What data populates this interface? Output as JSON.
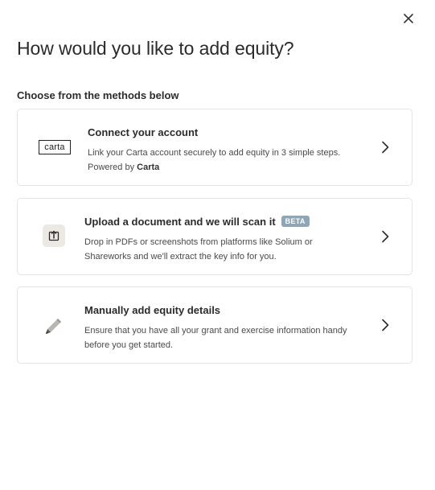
{
  "dialog": {
    "title": "How would you like to add equity?",
    "subtitle": "Choose from the methods below",
    "close_icon": "close-icon"
  },
  "methods": [
    {
      "title": "Connect your account",
      "logo_text": "carta",
      "description": "Link your Carta account securely to add equity in 3 simple steps.",
      "powered_by_prefix": "Powered by",
      "powered_by_brand": "Carta",
      "icon": "carta-logo",
      "chevron": "chevron-right-icon"
    },
    {
      "title": "Upload a document and we will scan it",
      "badge": "BETA",
      "description": "Drop in PDFs or screenshots from platforms like Solium or Shareworks and we'll extract the key info for you.",
      "icon": "upload-icon",
      "chevron": "chevron-right-icon"
    },
    {
      "title": "Manually add equity details",
      "description": "Ensure that you have all your grant and exercise information handy before you get started.",
      "icon": "pencil-icon",
      "chevron": "chevron-right-icon"
    }
  ],
  "colors": {
    "text_primary": "#2b2b2b",
    "text_secondary": "#4a4a4a",
    "card_border": "#e4e4e4",
    "badge_bg": "#8ea6b6",
    "upload_icon_bg": "#ece8e3"
  }
}
